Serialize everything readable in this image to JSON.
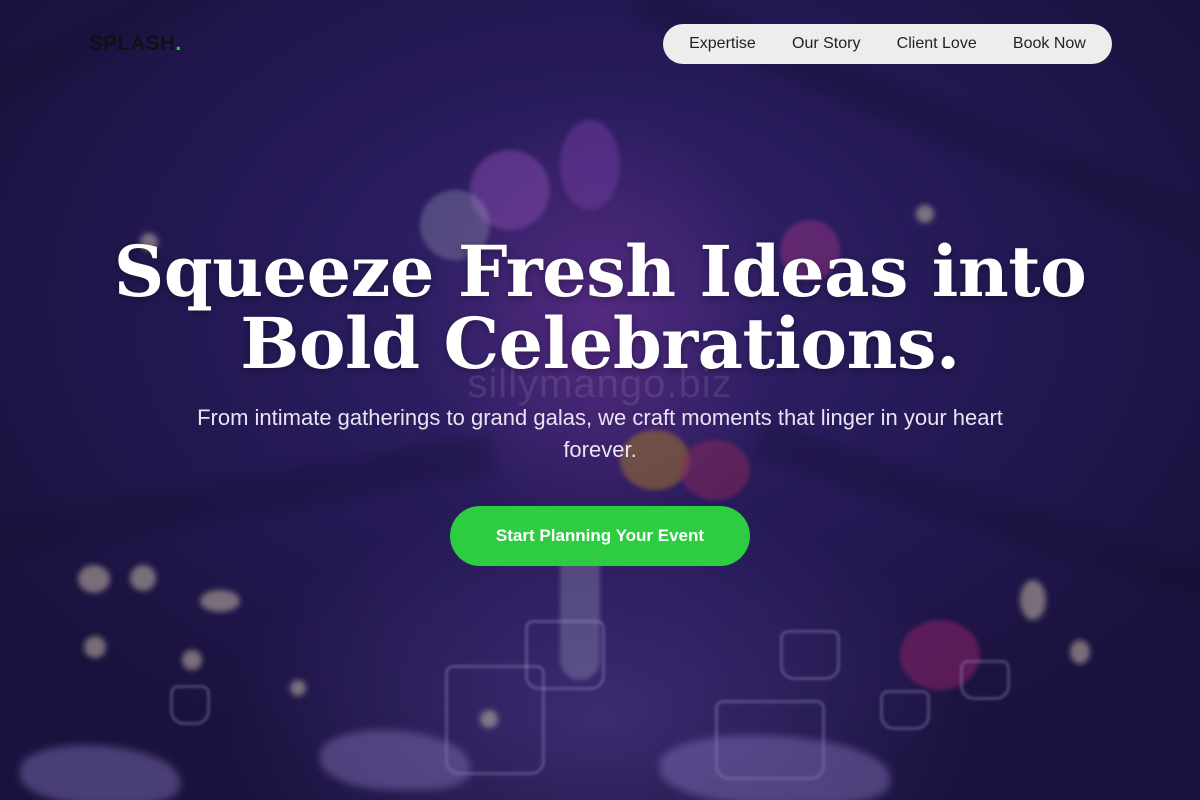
{
  "brand": {
    "name": "SPLASH",
    "dot": ".",
    "accent_color": "#2ecc40"
  },
  "nav": {
    "items": [
      {
        "label": "Expertise"
      },
      {
        "label": "Our Story"
      },
      {
        "label": "Client Love"
      },
      {
        "label": "Book Now"
      }
    ]
  },
  "hero": {
    "headline_line1": "Squeeze Fresh Ideas into",
    "headline_line2": "Bold Celebrations.",
    "subheadline": "From intimate gatherings to grand galas, we craft moments that linger in your heart forever.",
    "cta_label": "Start Planning Your Event",
    "watermark": "sillymango.biz",
    "background_image": "purple-lit-event-table-with-floral-centerpiece"
  }
}
